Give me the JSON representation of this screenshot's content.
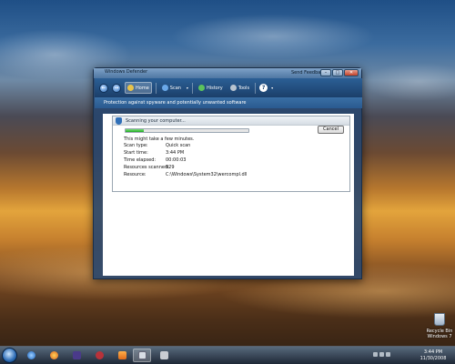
{
  "window": {
    "title": "Windows Defender",
    "send_feedback": "Send Feedback",
    "buttons": {
      "minimize": "–",
      "maximize": "□",
      "close": "✕"
    }
  },
  "toolbar": {
    "back": "←",
    "forward": "→",
    "home": "Home",
    "scan": "Scan",
    "history": "History",
    "tools": "Tools",
    "help": "?",
    "dropdown": "▾"
  },
  "subtitle": "Protection against spyware and potentially unwanted software",
  "scan": {
    "header": "Scanning your computer...",
    "progress": 0.15,
    "cancel_label": "Cancel",
    "note": "This might take a few minutes.",
    "details": [
      {
        "label": "Scan type:",
        "value": "Quick scan"
      },
      {
        "label": "Start time:",
        "value": "3:44 PM"
      },
      {
        "label": "Time elapsed:",
        "value": "00:00:03"
      },
      {
        "label": "Resources scanned:",
        "value": "929"
      },
      {
        "label": "Resource:",
        "value": "C:\\Windows\\System32\\wercompl.dll"
      }
    ]
  },
  "desktop": {
    "recycle_bin": {
      "line1": "Recycle Bin",
      "line2": "Windows 7"
    }
  },
  "taskbar": {
    "clock_time": "3:44 PM",
    "clock_date": "11/30/2008",
    "apps": [
      "start-orb",
      "internet-explorer",
      "firefox",
      "app-3",
      "media-player",
      "windows-defender",
      "app-6"
    ]
  },
  "colors": {
    "accent": "#1b3f6a",
    "progress": "#1faa1f"
  }
}
